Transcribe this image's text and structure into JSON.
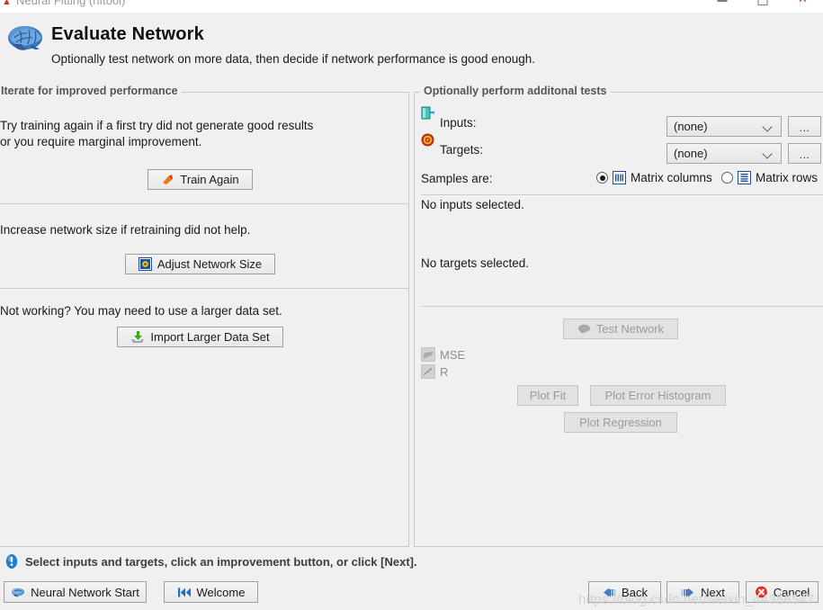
{
  "window": {
    "title": "Neural Fitting (nftool)",
    "app_icon": "matlab-nn-icon",
    "controls": {
      "minimize": "minimize-button",
      "maximize": "maximize-button",
      "close": "close-button"
    }
  },
  "header": {
    "title": "Evaluate Network",
    "subtitle": "Optionally test network on more data, then decide if network performance is good enough.",
    "icon": "brain-icon"
  },
  "left_panel": {
    "legend": "Iterate for improved performance",
    "section1": {
      "line1": "Try training again if a first try did not generate good results",
      "line2": "or you require marginal improvement.",
      "button": "Train Again",
      "button_icon": "retrain-icon"
    },
    "section2": {
      "text": "Increase network size if retraining did not help.",
      "button": "Adjust Network Size",
      "button_icon": "network-size-icon"
    },
    "section3": {
      "text": "Not working? You may need to use a larger data set.",
      "button": "Import Larger Data Set",
      "button_icon": "import-icon"
    }
  },
  "right_panel": {
    "legend": "Optionally perform additonal tests",
    "inputs": {
      "label": "Inputs:",
      "icon": "inputs-icon",
      "value": "(none)",
      "browse": "...",
      "status": "No inputs selected."
    },
    "targets": {
      "label": "Targets:",
      "icon": "targets-icon",
      "value": "(none)",
      "browse": "...",
      "status": "No targets selected."
    },
    "samples": {
      "label": "Samples are:",
      "option_columns": "Matrix columns",
      "option_rows": "Matrix rows",
      "selected": "Matrix columns",
      "columns_icon": "matrix-columns-icon",
      "rows_icon": "matrix-rows-icon"
    },
    "test_button": "Test Network",
    "test_button_icon": "brain-small-icon",
    "metrics": [
      {
        "label": "MSE",
        "icon": "mse-icon"
      },
      {
        "label": "R",
        "icon": "r-icon"
      }
    ],
    "plot_buttons": {
      "plot_fit": "Plot Fit",
      "plot_error_histogram": "Plot Error Histogram",
      "plot_regression": "Plot Regression"
    }
  },
  "status": {
    "icon": "info-icon",
    "message": "Select inputs and targets, click an improvement button, or click [Next]."
  },
  "footer": {
    "neural_network_start": "Neural Network Start",
    "neural_network_start_icon": "brain-small-icon",
    "welcome": "Welcome",
    "welcome_icon": "rewind-icon",
    "back": "Back",
    "back_icon": "back-arrow-icon",
    "next": "Next",
    "next_icon": "next-arrow-icon",
    "cancel": "Cancel",
    "cancel_icon": "cancel-icon"
  },
  "watermark": "https://blog.csdn.net/weixin_44386547",
  "colors": {
    "background": "#f0f0f0",
    "accent_blue": "#1b6fc4",
    "disabled_text": "#9b9b9b",
    "legend_text": "#555555"
  }
}
